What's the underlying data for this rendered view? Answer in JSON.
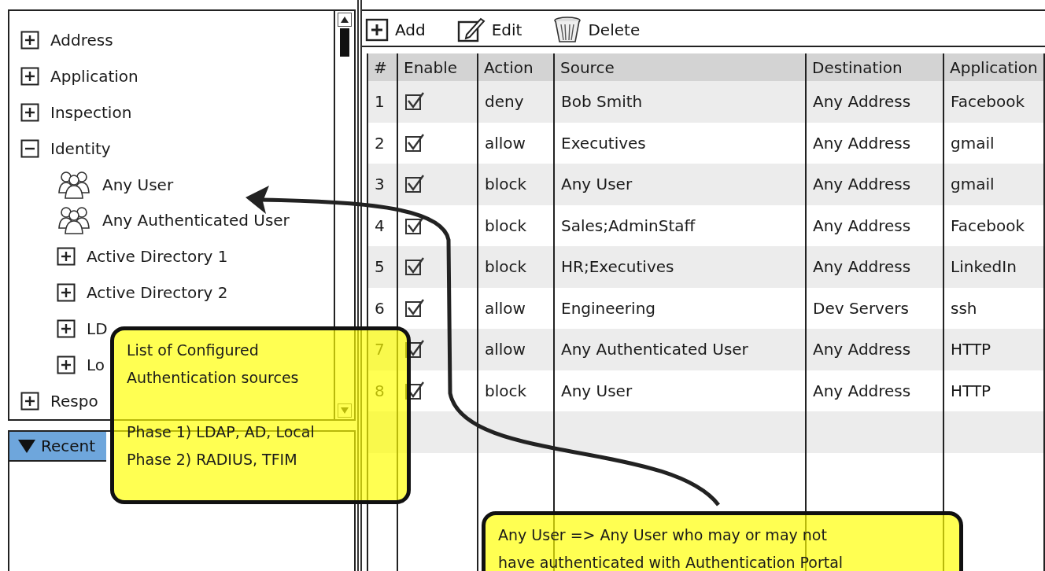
{
  "tree": [
    {
      "label": "Address",
      "kind": "folder",
      "expanded": false
    },
    {
      "label": "Application",
      "kind": "folder",
      "expanded": false
    },
    {
      "label": "Inspection",
      "kind": "folder",
      "expanded": false
    },
    {
      "label": "Identity",
      "kind": "folder",
      "expanded": true,
      "children": [
        {
          "label": "Any User",
          "kind": "group"
        },
        {
          "label": "Any Authenticated User",
          "kind": "group"
        },
        {
          "label": "Active Directory 1",
          "kind": "folder",
          "expanded": false
        },
        {
          "label": "Active Directory 2",
          "kind": "folder",
          "expanded": false
        },
        {
          "label": "LD",
          "kind": "folder",
          "expanded": false
        },
        {
          "label": "Lo",
          "kind": "folder",
          "expanded": false
        }
      ]
    },
    {
      "label": "Respo",
      "kind": "folder",
      "expanded": false
    }
  ],
  "recent_activity": {
    "title": "Recent",
    "expanded": true
  },
  "toolbar": [
    {
      "label": "Add",
      "kind": "add"
    },
    {
      "label": "Edit",
      "kind": "edit"
    },
    {
      "label": "Delete",
      "kind": "delete"
    }
  ],
  "table": {
    "columns": [
      "#",
      "Enable",
      "Action",
      "Source",
      "Destination",
      "Application"
    ],
    "rows": [
      {
        "number": "1",
        "enabled": true,
        "action": "deny",
        "source": "Bob Smith",
        "destination": "Any Address",
        "application": "Facebook"
      },
      {
        "number": "2",
        "enabled": true,
        "action": "allow",
        "source": "Executives",
        "destination": "Any Address",
        "application": "gmail"
      },
      {
        "number": "3",
        "enabled": true,
        "action": "block",
        "source": "Any User",
        "destination": "Any Address",
        "application": "gmail"
      },
      {
        "number": "4",
        "enabled": true,
        "action": "block",
        "source": "Sales;AdminStaff",
        "destination": "Any Address",
        "application": "Facebook"
      },
      {
        "number": "5",
        "enabled": true,
        "action": "block",
        "source": "HR;Executives",
        "destination": "Any Address",
        "application": "LinkedIn"
      },
      {
        "number": "6",
        "enabled": true,
        "action": "allow",
        "source": "Engineering",
        "destination": "Dev Servers",
        "application": "ssh"
      },
      {
        "number": "7",
        "enabled": true,
        "action": "allow",
        "source": "Any Authenticated User",
        "destination": "Any Address",
        "application": "HTTP"
      },
      {
        "number": "8",
        "enabled": true,
        "action": "block",
        "source": "Any User",
        "destination": "Any Address",
        "application": "HTTP"
      }
    ]
  },
  "notes": [
    {
      "paragraphs": [
        [
          "List of Configured",
          "Authentication sources"
        ],
        [
          "Phase 1) LDAP, AD, Local",
          "Phase 2) RADIUS, TFIM"
        ]
      ]
    },
    {
      "paragraphs": [
        [
          "Any User => Any User who may or may not",
          "have authenticated with Authentication Portal"
        ]
      ]
    }
  ]
}
